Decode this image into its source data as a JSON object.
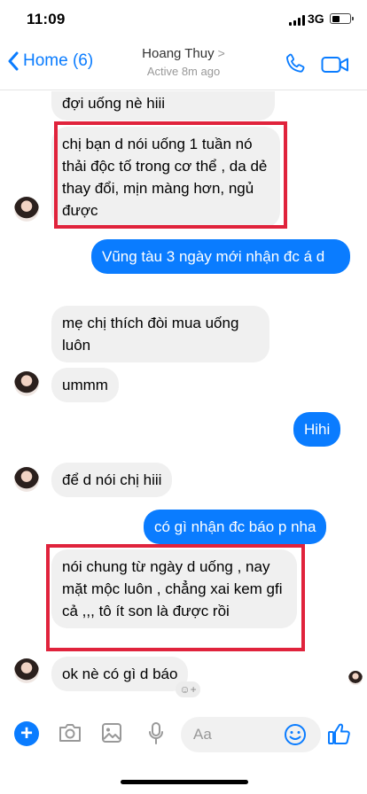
{
  "status_bar": {
    "time": "11:09",
    "network": "3G"
  },
  "header": {
    "back_label": "Home (6)",
    "contact_name": "Hoang Thuy",
    "contact_chevron": ">",
    "contact_status": "Active 8m ago"
  },
  "messages": [
    {
      "side": "in",
      "text": "p gửi chưa p hiii,,, họ đang đợi uống nè hiii"
    },
    {
      "side": "in",
      "text": "chị bạn d nói uống 1 tuần nó thải độc tố trong cơ thể , da dẻ thay đổi, mịn màng hơn, ngủ được"
    },
    {
      "side": "out",
      "text": "Vũng tàu 3 ngày mới nhận đc á d"
    },
    {
      "side": "in",
      "text": "mẹ chị thích đòi mua uống luôn"
    },
    {
      "side": "in",
      "text": "ummm"
    },
    {
      "side": "out",
      "text": "Hihi"
    },
    {
      "side": "in",
      "text": "để d nói chị hiii"
    },
    {
      "side": "out",
      "text": "có gì nhận đc báo p nha"
    },
    {
      "side": "in",
      "text": "nói chung từ ngày d uống , nay mặt mộc luôn , chẳng xai kem gfi cả ,,, tô ít son là được rồi"
    },
    {
      "side": "in",
      "text": "ok nè có gì d báo"
    }
  ],
  "composer": {
    "placeholder": "Aa",
    "reaction_badge": "☺+"
  },
  "colors": {
    "accent": "#0a7cff",
    "incoming_bubble": "#f0f0f0",
    "highlight": "#e0233c"
  },
  "icons": [
    "chevron-left-icon",
    "phone-icon",
    "video-camera-icon",
    "plus-icon",
    "camera-icon",
    "photo-icon",
    "microphone-icon",
    "smile-icon",
    "thumbs-up-icon"
  ]
}
